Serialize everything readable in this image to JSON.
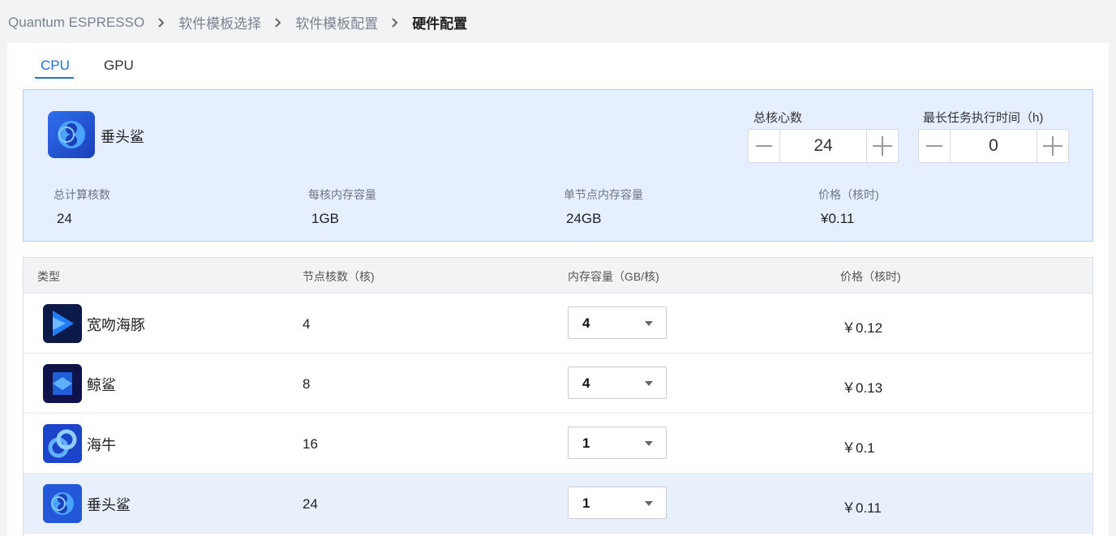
{
  "breadcrumb": {
    "items": [
      "Quantum ESPRESSO",
      "软件模板选择",
      "软件模板配置"
    ],
    "current": "硬件配置"
  },
  "tabs": {
    "cpu": "CPU",
    "gpu": "GPU",
    "active": "CPU"
  },
  "summary": {
    "name": "垂头鲨",
    "icon": "hammerhead-icon",
    "total_cores_label": "总核心数",
    "total_cores_value": "24",
    "max_time_label": "最长任务执行时间（h)",
    "max_time_value": "0",
    "stats": [
      {
        "label": "总计算核数",
        "value": "24"
      },
      {
        "label": "每核内存容量",
        "value": "1GB"
      },
      {
        "label": "单节点内存容量",
        "value": "24GB"
      },
      {
        "label": "价格（核时)",
        "value": "¥0.11"
      }
    ]
  },
  "table": {
    "headers": [
      "类型",
      "节点核数（核)",
      "内存容量（GB/核)",
      "价格（核时)"
    ],
    "rows": [
      {
        "name": "宽吻海豚",
        "icon": "dolphin-icon",
        "cores": "4",
        "memory": "4",
        "price": "￥0.12"
      },
      {
        "name": "鲸鲨",
        "icon": "whale-shark-icon",
        "cores": "8",
        "memory": "4",
        "price": "￥0.13"
      },
      {
        "name": "海牛",
        "icon": "manatee-icon",
        "cores": "16",
        "memory": "1",
        "price": "￥0.1"
      },
      {
        "name": "垂头鲨",
        "icon": "hammerhead-icon",
        "cores": "24",
        "memory": "1",
        "price": "￥0.11",
        "selected": true
      }
    ]
  },
  "colors": {
    "accent": "#1e6fe0",
    "summary_bg": "#e5efff",
    "selected_row": "#e8f0fc"
  }
}
